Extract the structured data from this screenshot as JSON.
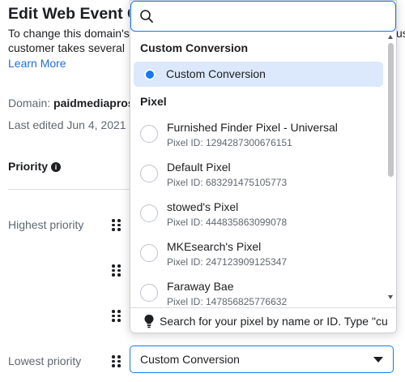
{
  "background": {
    "title": "Edit Web Event C",
    "desc_line1": "To change this domain's",
    "desc_line1_tail": "us",
    "desc_line2": "customer takes several",
    "learn_more": "Learn More",
    "domain_label": "Domain:",
    "domain_value": "paidmediapros",
    "last_edited": "Last edited Jun 4, 2021",
    "priority_title": "Priority",
    "highest_priority": "Highest priority",
    "lowest_priority": "Lowest priority",
    "lowest_select_value": "Custom Conversion"
  },
  "dropdown": {
    "search_value": "",
    "group_custom": "Custom Conversion",
    "selected_option": "Custom Conversion",
    "group_pixel": "Pixel",
    "pixels": [
      {
        "name": "Furnished Finder Pixel - Universal",
        "id": "Pixel ID: 1294287300676151"
      },
      {
        "name": "Default Pixel",
        "id": "Pixel ID: 683291475105773"
      },
      {
        "name": "stowed's Pixel",
        "id": "Pixel ID: 444835863099078"
      },
      {
        "name": "MKEsearch's Pixel",
        "id": "Pixel ID: 247123909125347"
      },
      {
        "name": "Faraway Bae",
        "id": "Pixel ID: 147856825776632"
      }
    ],
    "footer_hint": "Search for your pixel by name or ID. Type \"cu"
  },
  "colors": {
    "accent": "#1877f2",
    "selected_bg": "#dce8fb",
    "link": "#216fdb"
  },
  "icons": {
    "search": "search-icon",
    "info": "info-icon",
    "drag": "drag-handle-icon",
    "bulb": "lightbulb-icon",
    "caret": "caret-down-icon"
  }
}
